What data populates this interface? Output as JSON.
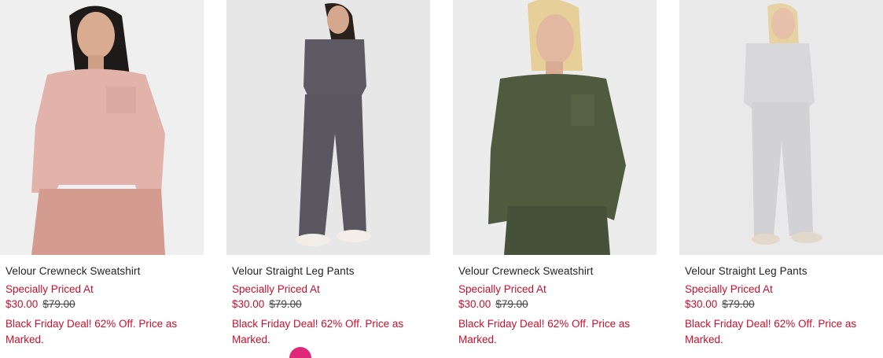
{
  "products": [
    {
      "name": "Velour Crewneck Sweatshirt",
      "promo_label": "Specially Priced At",
      "sale_price": "$30.00",
      "original_price": "$79.00",
      "deal_text": "Black Friday Deal! 62% Off. Price as Marked.",
      "garment_color": "#e2b3aa"
    },
    {
      "name": "Velour Straight Leg Pants",
      "promo_label": "Specially Priced At",
      "sale_price": "$30.00",
      "original_price": "$79.00",
      "deal_text": "Black Friday Deal! 62% Off. Price as Marked.",
      "garment_color": "#5d5a63"
    },
    {
      "name": "Velour Crewneck Sweatshirt",
      "promo_label": "Specially Priced At",
      "sale_price": "$30.00",
      "original_price": "$79.00",
      "deal_text": "Black Friday Deal! 62% Off. Price as Marked.",
      "garment_color": "#4f5a3e"
    },
    {
      "name": "Velour Straight Leg Pants",
      "promo_label": "Specially Priced At",
      "sale_price": "$30.00",
      "original_price": "$79.00",
      "deal_text": "Black Friday Deal! 62% Off. Price as Marked.",
      "garment_color": "#d8d8da"
    }
  ],
  "colors": {
    "sale_red": "#c8102e",
    "text_dark": "#222222",
    "photo_background": "#eeeeee"
  }
}
